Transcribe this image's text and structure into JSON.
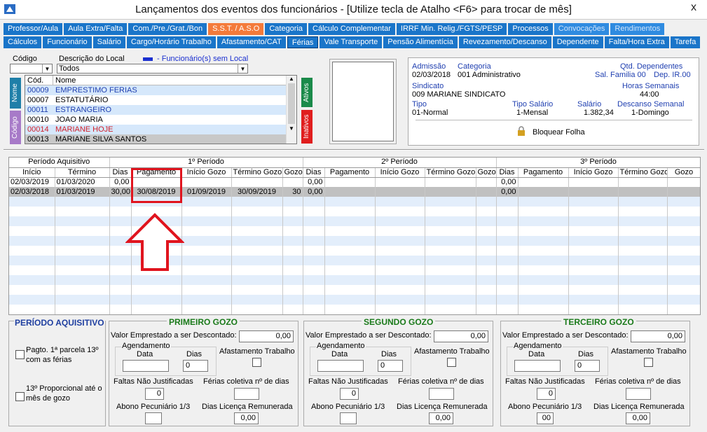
{
  "window": {
    "title": "Lançamentos dos eventos dos funcionários - [Utilize tecla de Atalho <F6> para trocar de mês]",
    "close": "x"
  },
  "tabs_row1": [
    {
      "label": "Professor/Aula",
      "style": "normal"
    },
    {
      "label": "Aula Extra/Falta",
      "style": "normal"
    },
    {
      "label": "Com./Pre./Grat./Bon",
      "style": "normal"
    },
    {
      "label": "S.S.T. / A.S.O",
      "style": "orange"
    },
    {
      "label": "Categoria",
      "style": "normal"
    },
    {
      "label": "Cálculo Complementar",
      "style": "normal"
    },
    {
      "label": "IRRF Min. Relig./FGTS/PESP",
      "style": "normal"
    },
    {
      "label": "Processos",
      "style": "normal"
    },
    {
      "label": "Convocações",
      "style": "light"
    },
    {
      "label": "Rendimentos",
      "style": "light"
    }
  ],
  "tabs_row2": [
    {
      "label": "Cálculos",
      "style": "normal"
    },
    {
      "label": "Funcionário",
      "style": "normal"
    },
    {
      "label": "Salário",
      "style": "normal"
    },
    {
      "label": "Cargo/Horário Trabalho",
      "style": "normal"
    },
    {
      "label": "Afastamento/CAT",
      "style": "normal"
    },
    {
      "label": "Férias",
      "style": "active"
    },
    {
      "label": "Vale Transporte",
      "style": "normal"
    },
    {
      "label": "Pensão Alimentícia",
      "style": "normal"
    },
    {
      "label": "Revezamento/Descanso",
      "style": "normal"
    },
    {
      "label": "Dependente",
      "style": "normal"
    },
    {
      "label": "Falta/Hora Extra",
      "style": "normal"
    },
    {
      "label": "Tarefa",
      "style": "normal"
    }
  ],
  "filters": {
    "codigo_label": "Código",
    "descricao_label": "Descrição do Local",
    "legend_text": "- Funcionário(s) sem Local",
    "descricao_value": "Todos",
    "codigo_value": ""
  },
  "side_tabs": {
    "nome": "Nome",
    "codigo": "Código",
    "ativos": "Ativos",
    "inativos": "Inativos"
  },
  "employees": {
    "headers": [
      "Cód.",
      "Nome"
    ],
    "rows": [
      {
        "cod": "00009",
        "nome": "EMPRESTIMO FERIAS",
        "color": "#1f3fb0",
        "bg": "#d6e8fb"
      },
      {
        "cod": "00007",
        "nome": "ESTATUTÁRIO",
        "color": "#000000",
        "bg": "#ffffff"
      },
      {
        "cod": "00011",
        "nome": "ESTRANGEIRO",
        "color": "#1f3fb0",
        "bg": "#d6e8fb"
      },
      {
        "cod": "00010",
        "nome": "JOAO MARIA",
        "color": "#000000",
        "bg": "#ffffff"
      },
      {
        "cod": "00014",
        "nome": "MARIANE HOJE",
        "color": "#d0202a",
        "bg": "#d6e8fb"
      },
      {
        "cod": "00013",
        "nome": "MARIANE SILVA SANTOS",
        "color": "#000000",
        "bg": "#c8c8c8"
      }
    ]
  },
  "info": {
    "admissao_label": "Admissão",
    "admissao": "02/03/2018",
    "categoria_label": "Categoria",
    "categoria": "001  Administrativo",
    "qtd_dep_label": "Qtd. Dependentes",
    "sal_familia": "Sal. Familia 00",
    "dep_ir": "Dep. IR.00",
    "sindicato_label": "Sindicato",
    "sindicato": "009 MARIANE SINDICATO",
    "horas_label": "Horas Semanais",
    "horas": "44:00",
    "tipo_label": "Tipo",
    "tipo": "01-Normal",
    "tipo_salario_label": "Tipo Salário",
    "tipo_salario": "1-Mensal",
    "salario_label": "Salário",
    "salario": "1.382,34",
    "descanso_label": "Descanso Semanal",
    "descanso": "1-Domingo",
    "bloquear": "Bloquear Folha"
  },
  "grid": {
    "groups": [
      "Período Aquisitivo",
      "1º Período",
      "2º Período",
      "3º Período"
    ],
    "cols": [
      "Início",
      "Término",
      "Dias",
      "Pagamento",
      "Início Gozo",
      "Término Gozo",
      "Gozo",
      "Dias",
      "Pagamento",
      "Início Gozo",
      "Término Gozo",
      "Gozo",
      "Dias",
      "Pagamento",
      "Início Gozo",
      "Término Gozo",
      "Gozo"
    ],
    "rows": [
      {
        "cells": [
          "02/03/2019",
          "01/03/2020",
          "0,00",
          "",
          "",
          "",
          "",
          "0,00",
          "",
          "",
          "",
          "",
          "0,00",
          "",
          "",
          "",
          ""
        ],
        "selected": false
      },
      {
        "cells": [
          "02/03/2018",
          "01/03/2019",
          "30,00",
          "30/08/2019",
          "01/09/2019",
          "30/09/2019",
          "30",
          "0,00",
          "",
          "",
          "",
          "",
          "0,00",
          "",
          "",
          "",
          ""
        ],
        "selected": true
      }
    ]
  },
  "periodo_aquisitivo": {
    "title": "PERÍODO AQUISITIVO",
    "chk1": "Pagto. 1ª parcela 13º com as férias",
    "chk2": "13º Proporcional até o mês de gozo"
  },
  "gozos": [
    {
      "title": "PRIMEIRO GOZO",
      "valor_label": "Valor Emprestado a ser Descontado:",
      "valor": "0,00",
      "agendamento": "Agendamento",
      "data_label": "Data",
      "dias_label": "Dias",
      "data": "",
      "dias": "0",
      "afastamento": "Afastamento Trabalho",
      "faltas_label": "Faltas Não Justificadas",
      "faltas": "0",
      "ferias_col_label": "Férias coletiva nº de dias",
      "ferias_col": "",
      "abono_label": "Abono Pecuniário 1/3",
      "abono": "",
      "licenca_label": "Dias Licença Remunerada",
      "licenca": "0,00"
    },
    {
      "title": "SEGUNDO GOZO",
      "valor_label": "Valor Emprestado a ser Descontado:",
      "valor": "0,00",
      "agendamento": "Agendamento",
      "data_label": "Data",
      "dias_label": "Dias",
      "data": "",
      "dias": "0",
      "afastamento": "Afastamento Trabalho",
      "faltas_label": "Faltas Não Justificadas",
      "faltas": "0",
      "ferias_col_label": "Férias coletiva nº de dias",
      "ferias_col": "",
      "abono_label": "Abono Pecuniário 1/3",
      "abono": "",
      "licenca_label": "Dias Licença Remunerada",
      "licenca": "0,00"
    },
    {
      "title": "TERCEIRO GOZO",
      "valor_label": "Valor Emprestado a ser Descontado:",
      "valor": "0,00",
      "agendamento": "Agendamento",
      "data_label": "Data",
      "dias_label": "Dias",
      "data": "",
      "dias": "0",
      "afastamento": "Afastamento Trabalho",
      "faltas_label": "Faltas Não Justificadas",
      "faltas": "0",
      "ferias_col_label": "Férias coletiva nº de dias",
      "ferias_col": "",
      "abono_label": "Abono Pecuniário 1/3",
      "abono": "00",
      "licenca_label": "Dias Licença Remunerada",
      "licenca": "0,00"
    }
  ],
  "colors": {
    "tab_blue": "#1a75c9",
    "tab_orange": "#f47a3a",
    "highlight_red": "#e0141e",
    "gozo_green": "#1a7a1a"
  }
}
